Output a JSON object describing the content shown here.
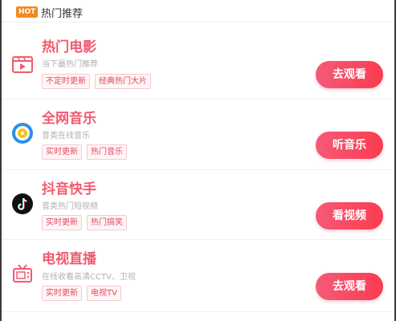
{
  "header": {
    "badge": "HOT",
    "title": "热门推荐"
  },
  "cards": [
    {
      "title": "热门电影",
      "subtitle": "当下最热门推荐",
      "tags": [
        "不定时更新",
        "经典热门大片"
      ],
      "action": "去观看",
      "icon": "movie-icon"
    },
    {
      "title": "全网音乐",
      "subtitle": "音类在线音乐",
      "tags": [
        "实时更新",
        "热门音乐"
      ],
      "action": "听音乐",
      "icon": "music-disc-icon"
    },
    {
      "title": "抖音快手",
      "subtitle": "音类热门短视频",
      "tags": [
        "实时更新",
        "热门搞笑"
      ],
      "action": "看视频",
      "icon": "tiktok-icon"
    },
    {
      "title": "电视直播",
      "subtitle": "在线收看高清CCTV、卫视",
      "tags": [
        "实时更新",
        "电视TV"
      ],
      "action": "去观看",
      "icon": "tv-icon"
    }
  ],
  "colors": {
    "accent": "#f25a6e",
    "button_start": "#f45a78",
    "button_end": "#fb3c4f",
    "badge": "#f08a24"
  }
}
